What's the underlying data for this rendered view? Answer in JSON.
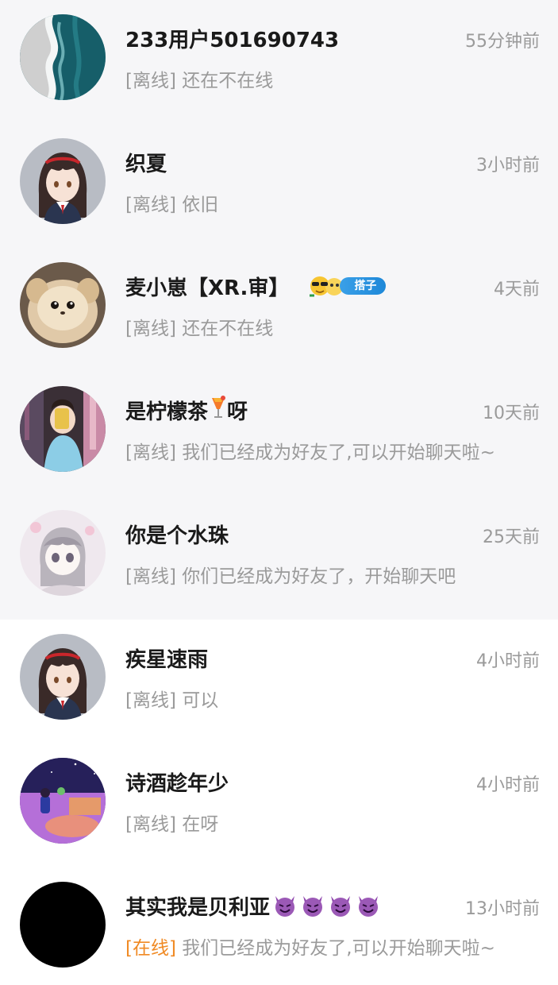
{
  "conversations": [
    {
      "name": "233用户501690743",
      "time": "55分钟前",
      "status": "[离线]",
      "message": "还在不在线",
      "pinned": true,
      "avatar": "sea-waves"
    },
    {
      "name": "织夏",
      "time": "3小时前",
      "status": "[离线]",
      "message": "依旧",
      "pinned": true,
      "avatar": "anime-girl"
    },
    {
      "name": "麦小崽【XR.审】",
      "badge_label": "搭子",
      "time": "4天前",
      "status": "[离线]",
      "message": "还在不在线",
      "pinned": true,
      "avatar": "fluffy-pet"
    },
    {
      "name": "是柠檬茶",
      "name_suffix": "呀",
      "time": "10天前",
      "status": "[离线]",
      "message": "我们已经成为好友了,可以开始聊天啦~",
      "pinned": true,
      "avatar": "mirror-selfie"
    },
    {
      "name": "你是个水珠",
      "time": "25天前",
      "status": "[离线]",
      "message": "你们已经成为好友了，开始聊天吧",
      "pinned": true,
      "avatar": "anime-sketch"
    },
    {
      "name": "疾星速雨",
      "time": "4小时前",
      "status": "[离线]",
      "message": "可以",
      "pinned": false,
      "avatar": "anime-girl"
    },
    {
      "name": "诗酒趁年少",
      "time": "4小时前",
      "status": "[离线]",
      "message": "在呀",
      "pinned": false,
      "avatar": "purple-room"
    },
    {
      "name": "其实我是贝利亚",
      "time": "13小时前",
      "status": "[在线]",
      "message": "我们已经成为好友了,可以开始聊天啦~",
      "pinned": false,
      "online": true,
      "avatar": "black-circle"
    }
  ],
  "icons": {
    "devil": "smiling-devil-emoji",
    "drink": "tropical-drink-emoji",
    "badge": "cool-sunglasses-emoji"
  },
  "colors": {
    "pinned_bg": "#f6f6f8",
    "online_status": "#f08a24",
    "muted_text": "#9a9a9a"
  }
}
